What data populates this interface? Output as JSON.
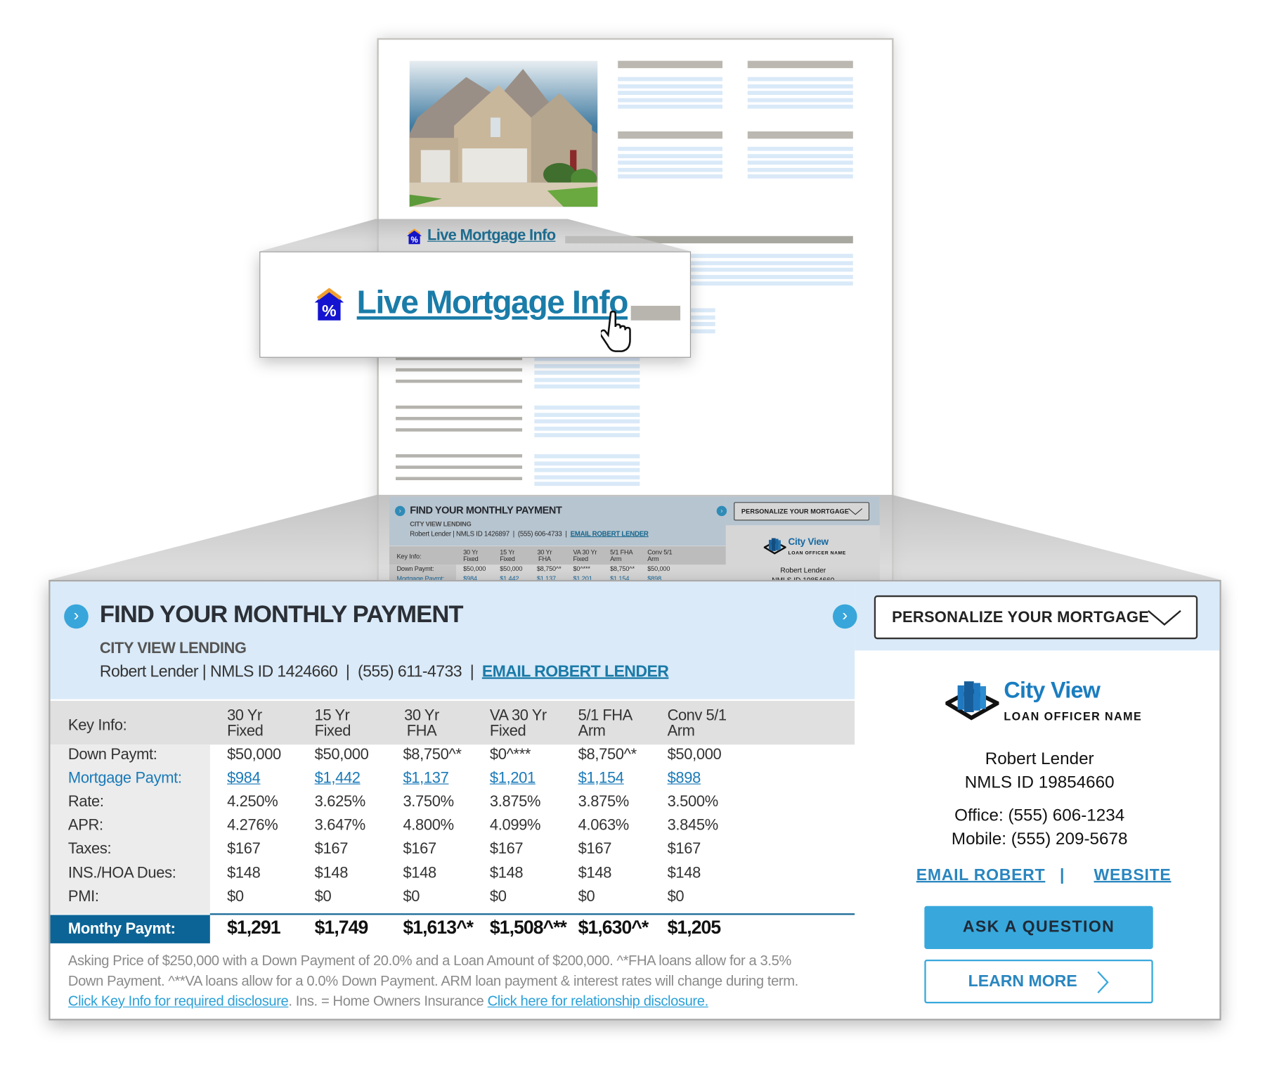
{
  "document": {
    "link_label": "Live Mortgage Info"
  },
  "callout": {
    "link_label": "Live Mortgage Info"
  },
  "widget": {
    "title": "FIND YOUR MONTHLY PAYMENT",
    "company": "CITY VIEW LENDING",
    "contact": {
      "name_nmls": "Robert Lender | NMLS ID 1424660",
      "separator": "|",
      "phone": "(555) 611-4733",
      "email_link": "EMAIL ROBERT LENDER"
    },
    "mini_contact": {
      "name_nmls": "Robert Lender | NMLS ID 1426897",
      "phone": "(555) 606-4733"
    },
    "table": {
      "key_label": "Key Info:",
      "columns": [
        {
          "line1": "30 Yr",
          "line2": "Fixed"
        },
        {
          "line1": "15 Yr",
          "line2": "Fixed"
        },
        {
          "line1": "30 Yr",
          "line2": "FHA"
        },
        {
          "line1": "VA 30 Yr",
          "line2": "Fixed"
        },
        {
          "line1": "5/1 FHA",
          "line2": "Arm"
        },
        {
          "line1": "Conv 5/1",
          "line2": "Arm"
        }
      ],
      "rows": [
        {
          "label": "Down Paymt:",
          "link": false,
          "values": [
            "$50,000",
            "$50,000",
            "$8,750^*",
            "$0^***",
            "$8,750^*",
            "$50,000"
          ]
        },
        {
          "label": "Mortgage Paymt:",
          "link": true,
          "values": [
            "$984",
            "$1,442",
            "$1,137",
            "$1,201",
            "$1,154",
            "$898"
          ]
        },
        {
          "label": "Rate:",
          "link": false,
          "values": [
            "4.250%",
            "3.625%",
            "3.750%",
            "3.875%",
            "3.875%",
            "3.500%"
          ]
        },
        {
          "label": "APR:",
          "link": false,
          "values": [
            "4.276%",
            "3.647%",
            "4.800%",
            "4.099%",
            "4.063%",
            "3.845%"
          ]
        },
        {
          "label": "Taxes:",
          "link": false,
          "values": [
            "$167",
            "$167",
            "$167",
            "$167",
            "$167",
            "$167"
          ]
        },
        {
          "label": "INS./HOA Dues:",
          "link": false,
          "values": [
            "$148",
            "$148",
            "$148",
            "$148",
            "$148",
            "$148"
          ]
        },
        {
          "label": "PMI:",
          "link": false,
          "values": [
            "$0",
            "$0",
            "$0",
            "$0",
            "$0",
            "$0"
          ]
        }
      ],
      "total": {
        "label": "Monthy Paymt:",
        "values": [
          "$1,291",
          "$1,749",
          "$1,613^*",
          "$1,508^**",
          "$1,630^*",
          "$1,205"
        ]
      }
    },
    "footnote": {
      "line1": "Asking Price of $250,000 with a Down Payment of 20.0% and a Loan Amount of $200,000. ^*FHA loans allow for a 3.5%",
      "line2": "Down Payment. ^**VA loans allow for a 0.0% Down Payment. ARM loan payment & interest rates will change during term.",
      "link1": "Click Key Info for required disclosure",
      "middle": ". Ins. = Home Owners Insurance ",
      "link2": "Click here for relationship disclosure."
    },
    "dropdown": {
      "label": "PERSONALIZE YOUR MORTGAGE"
    },
    "card": {
      "brand": "City View",
      "subtitle": "LOAN OFFICER NAME",
      "name": "Robert Lender",
      "nmls": "NMLS ID 19854660",
      "office": "Office: (555) 606-1234",
      "mobile": "Mobile:  (555) 209-5678",
      "email_link": "EMAIL ROBERT",
      "separator": "|",
      "website_link": "WEBSITE",
      "ask_button": "ASK A QUESTION",
      "learn_button": "LEARN MORE"
    }
  },
  "colors": {
    "header_bg": "#daeaf8",
    "accent_blue": "#38a8dc",
    "link_blue": "#1a7ab8",
    "total_label_bg": "#0c6496"
  }
}
